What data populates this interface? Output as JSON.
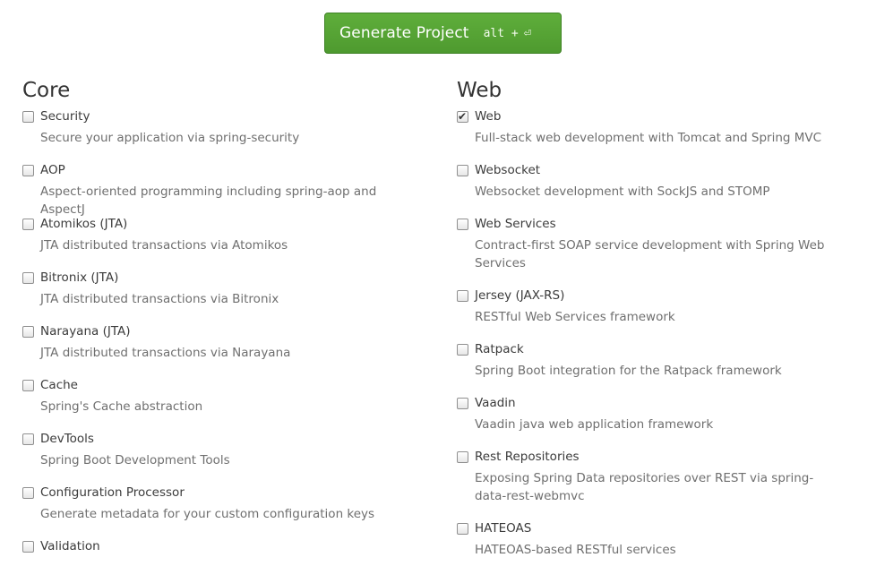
{
  "generate": {
    "label": "Generate Project",
    "shortcut": "alt +",
    "enter_icon": "enter-icon"
  },
  "core": {
    "title": "Core",
    "items": [
      {
        "name": "Security",
        "desc": "Secure your application via spring-security",
        "checked": false
      },
      {
        "name": "AOP",
        "desc": "Aspect-oriented programming including spring-aop and AspectJ",
        "checked": false
      },
      {
        "name": "Atomikos (JTA)",
        "desc": "JTA distributed transactions via Atomikos",
        "checked": false
      },
      {
        "name": "Bitronix (JTA)",
        "desc": "JTA distributed transactions via Bitronix",
        "checked": false
      },
      {
        "name": "Narayana (JTA)",
        "desc": "JTA distributed transactions via Narayana",
        "checked": false
      },
      {
        "name": "Cache",
        "desc": "Spring's Cache abstraction",
        "checked": false
      },
      {
        "name": "DevTools",
        "desc": "Spring Boot Development Tools",
        "checked": false
      },
      {
        "name": "Configuration Processor",
        "desc": "Generate metadata for your custom configuration keys",
        "checked": false
      },
      {
        "name": "Validation",
        "desc": "",
        "checked": false
      }
    ]
  },
  "web": {
    "title": "Web",
    "items": [
      {
        "name": "Web",
        "desc": "Full-stack web development with Tomcat and Spring MVC",
        "checked": true
      },
      {
        "name": "Websocket",
        "desc": "Websocket development with SockJS and STOMP",
        "checked": false
      },
      {
        "name": "Web Services",
        "desc": "Contract-first SOAP service development with Spring Web Services",
        "checked": false
      },
      {
        "name": "Jersey (JAX-RS)",
        "desc": "RESTful Web Services framework",
        "checked": false
      },
      {
        "name": "Ratpack",
        "desc": "Spring Boot integration for the Ratpack framework",
        "checked": false
      },
      {
        "name": "Vaadin",
        "desc": "Vaadin java web application framework",
        "checked": false
      },
      {
        "name": "Rest Repositories",
        "desc": "Exposing Spring Data repositories over REST via spring-data-rest-webmvc",
        "checked": false
      },
      {
        "name": "HATEOAS",
        "desc": "HATEOAS-based RESTful services",
        "checked": false
      }
    ]
  }
}
